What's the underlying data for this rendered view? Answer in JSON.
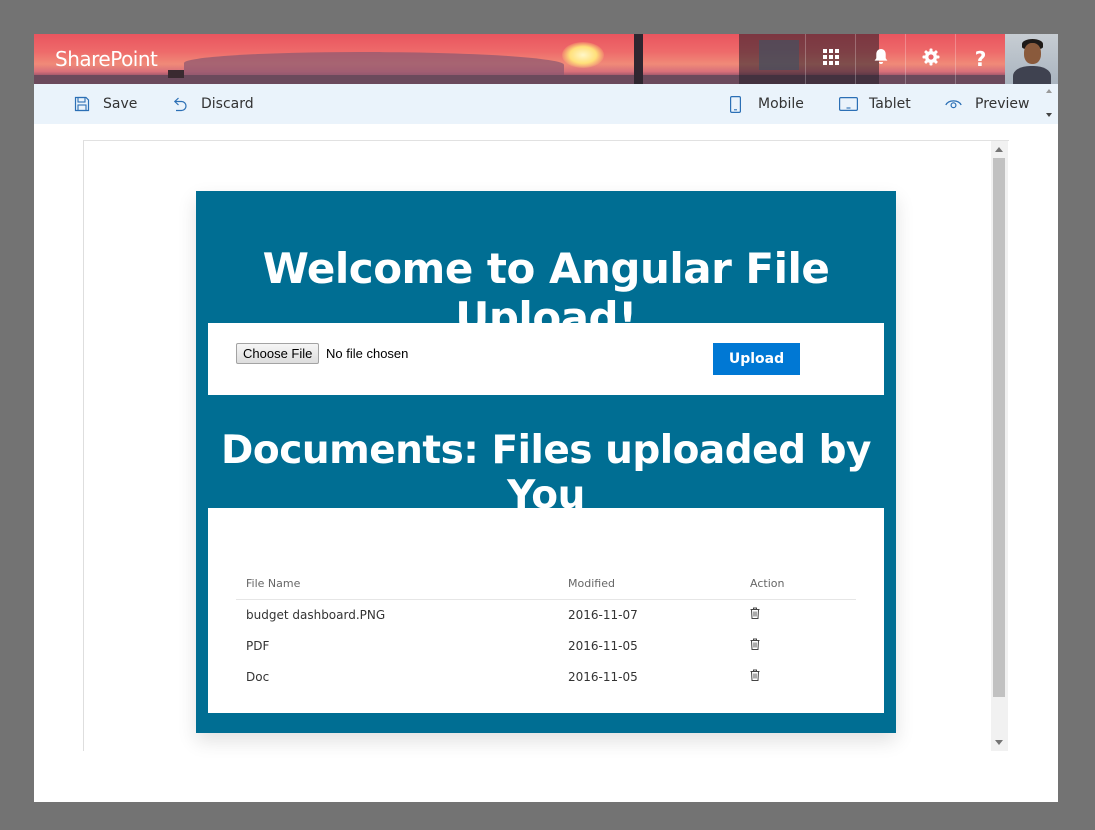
{
  "suite_bar": {
    "brand": "SharePoint",
    "icons": [
      "app-launcher-icon",
      "bell-icon",
      "gear-icon",
      "help-icon"
    ],
    "help_glyph": "?"
  },
  "command_bar": {
    "save_label": "Save",
    "discard_label": "Discard",
    "mobile_label": "Mobile",
    "tablet_label": "Tablet",
    "preview_label": "Preview"
  },
  "webpart": {
    "title": "Welcome to Angular File Upload!",
    "file_input": {
      "button_label": "Choose File",
      "status": "No file chosen"
    },
    "upload_label": "Upload",
    "subtitle": "Documents: Files uploaded by You",
    "table": {
      "columns": [
        "File Name",
        "Modified",
        "Action"
      ],
      "rows": [
        {
          "name": "budget dashboard.PNG",
          "modified": "2016-11-07",
          "action": "trash-icon"
        },
        {
          "name": "PDF",
          "modified": "2016-11-05",
          "action": "trash-icon"
        },
        {
          "name": "Doc",
          "modified": "2016-11-05",
          "action": "trash-icon"
        }
      ]
    }
  },
  "colors": {
    "webpart_bg": "#006e93",
    "accent": "#0078d4",
    "command_bar_bg": "#eaf3fb"
  }
}
